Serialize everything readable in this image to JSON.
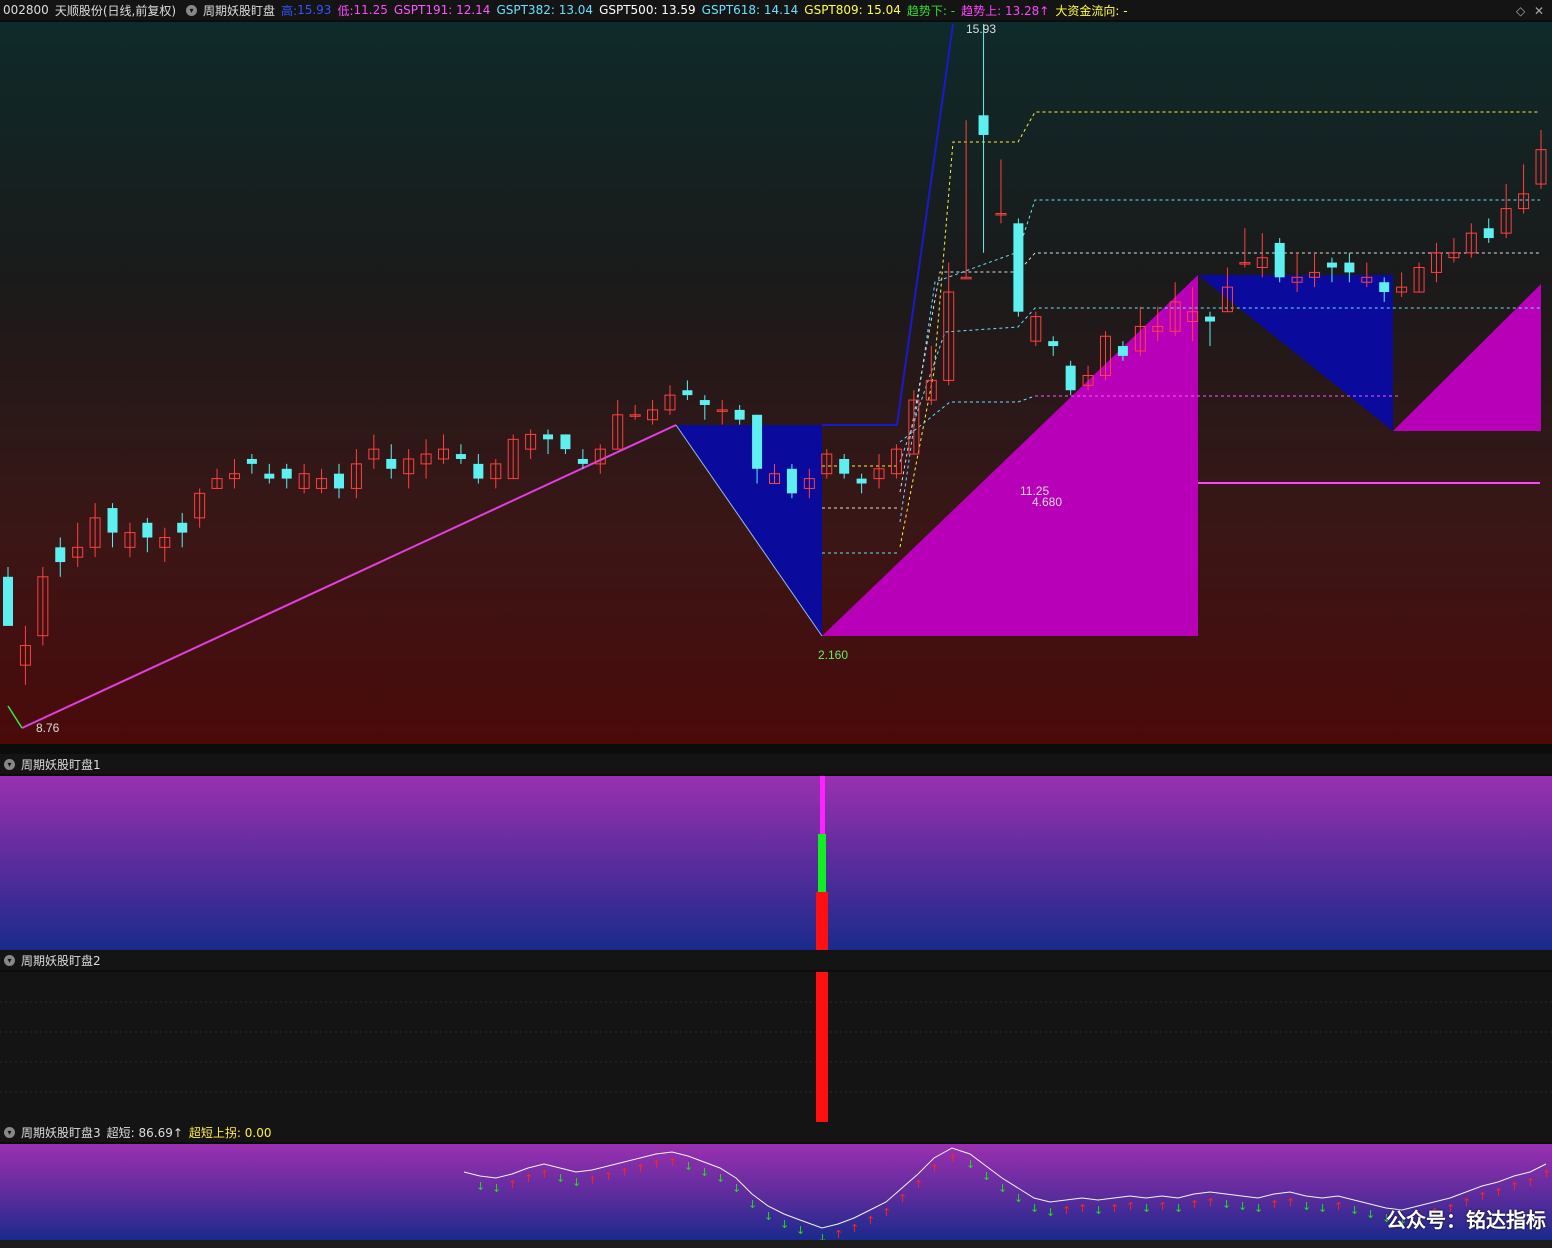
{
  "header": {
    "code": "002800",
    "name": "天顺股份",
    "period": "(日线,前复权)",
    "indicator": "周期妖股盯盘",
    "high_label": "高:",
    "high_val": "15.93",
    "low_label": "低:",
    "low_val": "11.25",
    "g191": "GSPT191: 12.14",
    "g382": "GSPT382: 13.04",
    "g500": "GSPT500: 13.59",
    "g618": "GSPT618: 14.14",
    "g809": "GSPT809: 15.04",
    "trend_down": "趋势下: -",
    "trend_up": "趋势上: 13.28↑",
    "capital": "大资金流向: -",
    "right_icons": [
      "◇",
      "✕"
    ],
    "colors": {
      "high": "#3355ff",
      "low": "#ff44ff",
      "g191": "#ff55ff",
      "g382": "#66e0ff",
      "g500": "#ffffff",
      "g618": "#66e0ff",
      "g809": "#ffff44",
      "trend_down": "#33dd33",
      "trend_up": "#ff44ff",
      "capital": "#ffff44"
    }
  },
  "main_labels": {
    "max": "15.93",
    "min": "8.76",
    "l1": "2.160",
    "l2": "11.25",
    "l3": "4.680"
  },
  "panel1": {
    "title": "周期妖股盯盘1"
  },
  "panel2": {
    "title": "周期妖股盯盘2"
  },
  "panel3": {
    "title": "周期妖股盯盘3",
    "ultra_short": "超短: 86.69↑",
    "ultra_turn": "超短上拐: 0.00"
  },
  "watermark": "公众号：铭达指标",
  "chart_data": {
    "type": "candlestick",
    "bull_color": "#ff4040",
    "bear_color": "#5ef0f0",
    "candles": [
      {
        "o": 10.3,
        "c": 9.8,
        "h": 10.4,
        "l": 9.8
      },
      {
        "o": 9.4,
        "c": 9.6,
        "h": 9.8,
        "l": 9.2
      },
      {
        "o": 9.7,
        "c": 10.3,
        "h": 10.4,
        "l": 9.6
      },
      {
        "o": 10.6,
        "c": 10.45,
        "h": 10.7,
        "l": 10.3
      },
      {
        "o": 10.5,
        "c": 10.6,
        "h": 10.85,
        "l": 10.4
      },
      {
        "o": 10.6,
        "c": 10.9,
        "h": 11.05,
        "l": 10.5
      },
      {
        "o": 11.0,
        "c": 10.75,
        "h": 11.05,
        "l": 10.6
      },
      {
        "o": 10.6,
        "c": 10.75,
        "h": 10.85,
        "l": 10.5
      },
      {
        "o": 10.85,
        "c": 10.7,
        "h": 10.9,
        "l": 10.55
      },
      {
        "o": 10.6,
        "c": 10.7,
        "h": 10.8,
        "l": 10.45
      },
      {
        "o": 10.85,
        "c": 10.75,
        "h": 10.95,
        "l": 10.6
      },
      {
        "o": 10.9,
        "c": 11.15,
        "h": 11.2,
        "l": 10.8
      },
      {
        "o": 11.2,
        "c": 11.3,
        "h": 11.4,
        "l": 11.2
      },
      {
        "o": 11.3,
        "c": 11.35,
        "h": 11.5,
        "l": 11.2
      },
      {
        "o": 11.5,
        "c": 11.45,
        "h": 11.55,
        "l": 11.35
      },
      {
        "o": 11.35,
        "c": 11.3,
        "h": 11.45,
        "l": 11.25
      },
      {
        "o": 11.4,
        "c": 11.3,
        "h": 11.45,
        "l": 11.2
      },
      {
        "o": 11.2,
        "c": 11.35,
        "h": 11.45,
        "l": 11.15
      },
      {
        "o": 11.2,
        "c": 11.3,
        "h": 11.4,
        "l": 11.15
      },
      {
        "o": 11.35,
        "c": 11.2,
        "h": 11.45,
        "l": 11.1
      },
      {
        "o": 11.2,
        "c": 11.45,
        "h": 11.6,
        "l": 11.1
      },
      {
        "o": 11.5,
        "c": 11.6,
        "h": 11.75,
        "l": 11.4
      },
      {
        "o": 11.5,
        "c": 11.4,
        "h": 11.65,
        "l": 11.3
      },
      {
        "o": 11.35,
        "c": 11.5,
        "h": 11.6,
        "l": 11.2
      },
      {
        "o": 11.45,
        "c": 11.55,
        "h": 11.7,
        "l": 11.3
      },
      {
        "o": 11.5,
        "c": 11.6,
        "h": 11.75,
        "l": 11.45
      },
      {
        "o": 11.55,
        "c": 11.5,
        "h": 11.65,
        "l": 11.45
      },
      {
        "o": 11.45,
        "c": 11.3,
        "h": 11.55,
        "l": 11.25
      },
      {
        "o": 11.3,
        "c": 11.45,
        "h": 11.5,
        "l": 11.2
      },
      {
        "o": 11.3,
        "c": 11.7,
        "h": 11.75,
        "l": 11.3
      },
      {
        "o": 11.6,
        "c": 11.75,
        "h": 11.8,
        "l": 11.5
      },
      {
        "o": 11.75,
        "c": 11.7,
        "h": 11.8,
        "l": 11.55
      },
      {
        "o": 11.75,
        "c": 11.6,
        "h": 11.75,
        "l": 11.55
      },
      {
        "o": 11.5,
        "c": 11.45,
        "h": 11.6,
        "l": 11.4
      },
      {
        "o": 11.45,
        "c": 11.6,
        "h": 11.65,
        "l": 11.35
      },
      {
        "o": 11.6,
        "c": 11.95,
        "h": 12.1,
        "l": 11.6
      },
      {
        "o": 11.95,
        "c": 11.95,
        "h": 12.05,
        "l": 11.9
      },
      {
        "o": 11.9,
        "c": 12.0,
        "h": 12.1,
        "l": 11.85
      },
      {
        "o": 12.0,
        "c": 12.15,
        "h": 12.25,
        "l": 11.95
      },
      {
        "o": 12.2,
        "c": 12.15,
        "h": 12.3,
        "l": 12.1
      },
      {
        "o": 12.1,
        "c": 12.05,
        "h": 12.15,
        "l": 11.9
      },
      {
        "o": 12.0,
        "c": 12.0,
        "h": 12.1,
        "l": 11.85
      },
      {
        "o": 12.0,
        "c": 11.9,
        "h": 12.05,
        "l": 11.85
      },
      {
        "o": 11.95,
        "c": 11.4,
        "h": 11.95,
        "l": 11.25
      },
      {
        "o": 11.25,
        "c": 11.35,
        "h": 11.45,
        "l": 11.25
      },
      {
        "o": 11.4,
        "c": 11.15,
        "h": 11.45,
        "l": 11.1
      },
      {
        "o": 11.2,
        "c": 11.3,
        "h": 11.4,
        "l": 11.1
      },
      {
        "o": 11.35,
        "c": 11.55,
        "h": 11.6,
        "l": 11.3
      },
      {
        "o": 11.5,
        "c": 11.35,
        "h": 11.55,
        "l": 11.3
      },
      {
        "o": 11.3,
        "c": 11.25,
        "h": 11.35,
        "l": 11.15
      },
      {
        "o": 11.3,
        "c": 11.4,
        "h": 11.55,
        "l": 11.2
      },
      {
        "o": 11.35,
        "c": 11.6,
        "h": 11.65,
        "l": 11.3
      },
      {
        "o": 11.55,
        "c": 12.1,
        "h": 12.2,
        "l": 11.55
      },
      {
        "o": 12.1,
        "c": 12.3,
        "h": 12.65,
        "l": 12.05
      },
      {
        "o": 12.3,
        "c": 13.2,
        "h": 13.5,
        "l": 12.25
      },
      {
        "o": 13.35,
        "c": 13.35,
        "h": 14.95,
        "l": 13.35
      },
      {
        "o": 15.0,
        "c": 14.8,
        "h": 15.93,
        "l": 13.6
      },
      {
        "o": 14.0,
        "c": 14.0,
        "h": 14.55,
        "l": 13.9
      },
      {
        "o": 13.9,
        "c": 13.0,
        "h": 13.95,
        "l": 12.95
      },
      {
        "o": 12.7,
        "c": 12.95,
        "h": 13.0,
        "l": 12.65
      },
      {
        "o": 12.7,
        "c": 12.65,
        "h": 12.75,
        "l": 12.55
      },
      {
        "o": 12.45,
        "c": 12.2,
        "h": 12.5,
        "l": 12.15
      },
      {
        "o": 12.25,
        "c": 12.35,
        "h": 12.45,
        "l": 12.2
      },
      {
        "o": 12.35,
        "c": 12.75,
        "h": 12.8,
        "l": 12.3
      },
      {
        "o": 12.65,
        "c": 12.55,
        "h": 12.7,
        "l": 12.5
      },
      {
        "o": 12.6,
        "c": 12.85,
        "h": 13.05,
        "l": 12.55
      },
      {
        "o": 12.8,
        "c": 12.85,
        "h": 13.05,
        "l": 12.7
      },
      {
        "o": 12.8,
        "c": 13.1,
        "h": 13.3,
        "l": 12.75
      },
      {
        "o": 12.9,
        "c": 13.0,
        "h": 13.25,
        "l": 12.7
      },
      {
        "o": 12.95,
        "c": 12.9,
        "h": 13.0,
        "l": 12.65
      },
      {
        "o": 13.0,
        "c": 13.25,
        "h": 13.45,
        "l": 13.0
      },
      {
        "o": 13.5,
        "c": 13.5,
        "h": 13.85,
        "l": 13.45
      },
      {
        "o": 13.45,
        "c": 13.55,
        "h": 13.8,
        "l": 13.35
      },
      {
        "o": 13.7,
        "c": 13.35,
        "h": 13.75,
        "l": 13.3
      },
      {
        "o": 13.3,
        "c": 13.35,
        "h": 13.6,
        "l": 13.2
      },
      {
        "o": 13.35,
        "c": 13.4,
        "h": 13.6,
        "l": 13.25
      },
      {
        "o": 13.5,
        "c": 13.45,
        "h": 13.55,
        "l": 13.3
      },
      {
        "o": 13.5,
        "c": 13.4,
        "h": 13.6,
        "l": 13.3
      },
      {
        "o": 13.3,
        "c": 13.35,
        "h": 13.5,
        "l": 13.25
      },
      {
        "o": 13.3,
        "c": 13.2,
        "h": 13.35,
        "l": 13.1
      },
      {
        "o": 13.2,
        "c": 13.25,
        "h": 13.4,
        "l": 13.15
      },
      {
        "o": 13.2,
        "c": 13.45,
        "h": 13.5,
        "l": 13.2
      },
      {
        "o": 13.4,
        "c": 13.6,
        "h": 13.7,
        "l": 13.3
      },
      {
        "o": 13.55,
        "c": 13.6,
        "h": 13.75,
        "l": 13.5
      },
      {
        "o": 13.6,
        "c": 13.8,
        "h": 13.9,
        "l": 13.55
      },
      {
        "o": 13.85,
        "c": 13.75,
        "h": 13.95,
        "l": 13.7
      },
      {
        "o": 13.8,
        "c": 14.05,
        "h": 14.3,
        "l": 13.75
      },
      {
        "o": 14.05,
        "c": 14.2,
        "h": 14.5,
        "l": 14.0
      },
      {
        "o": 14.3,
        "c": 14.65,
        "h": 14.85,
        "l": 14.25
      }
    ]
  }
}
